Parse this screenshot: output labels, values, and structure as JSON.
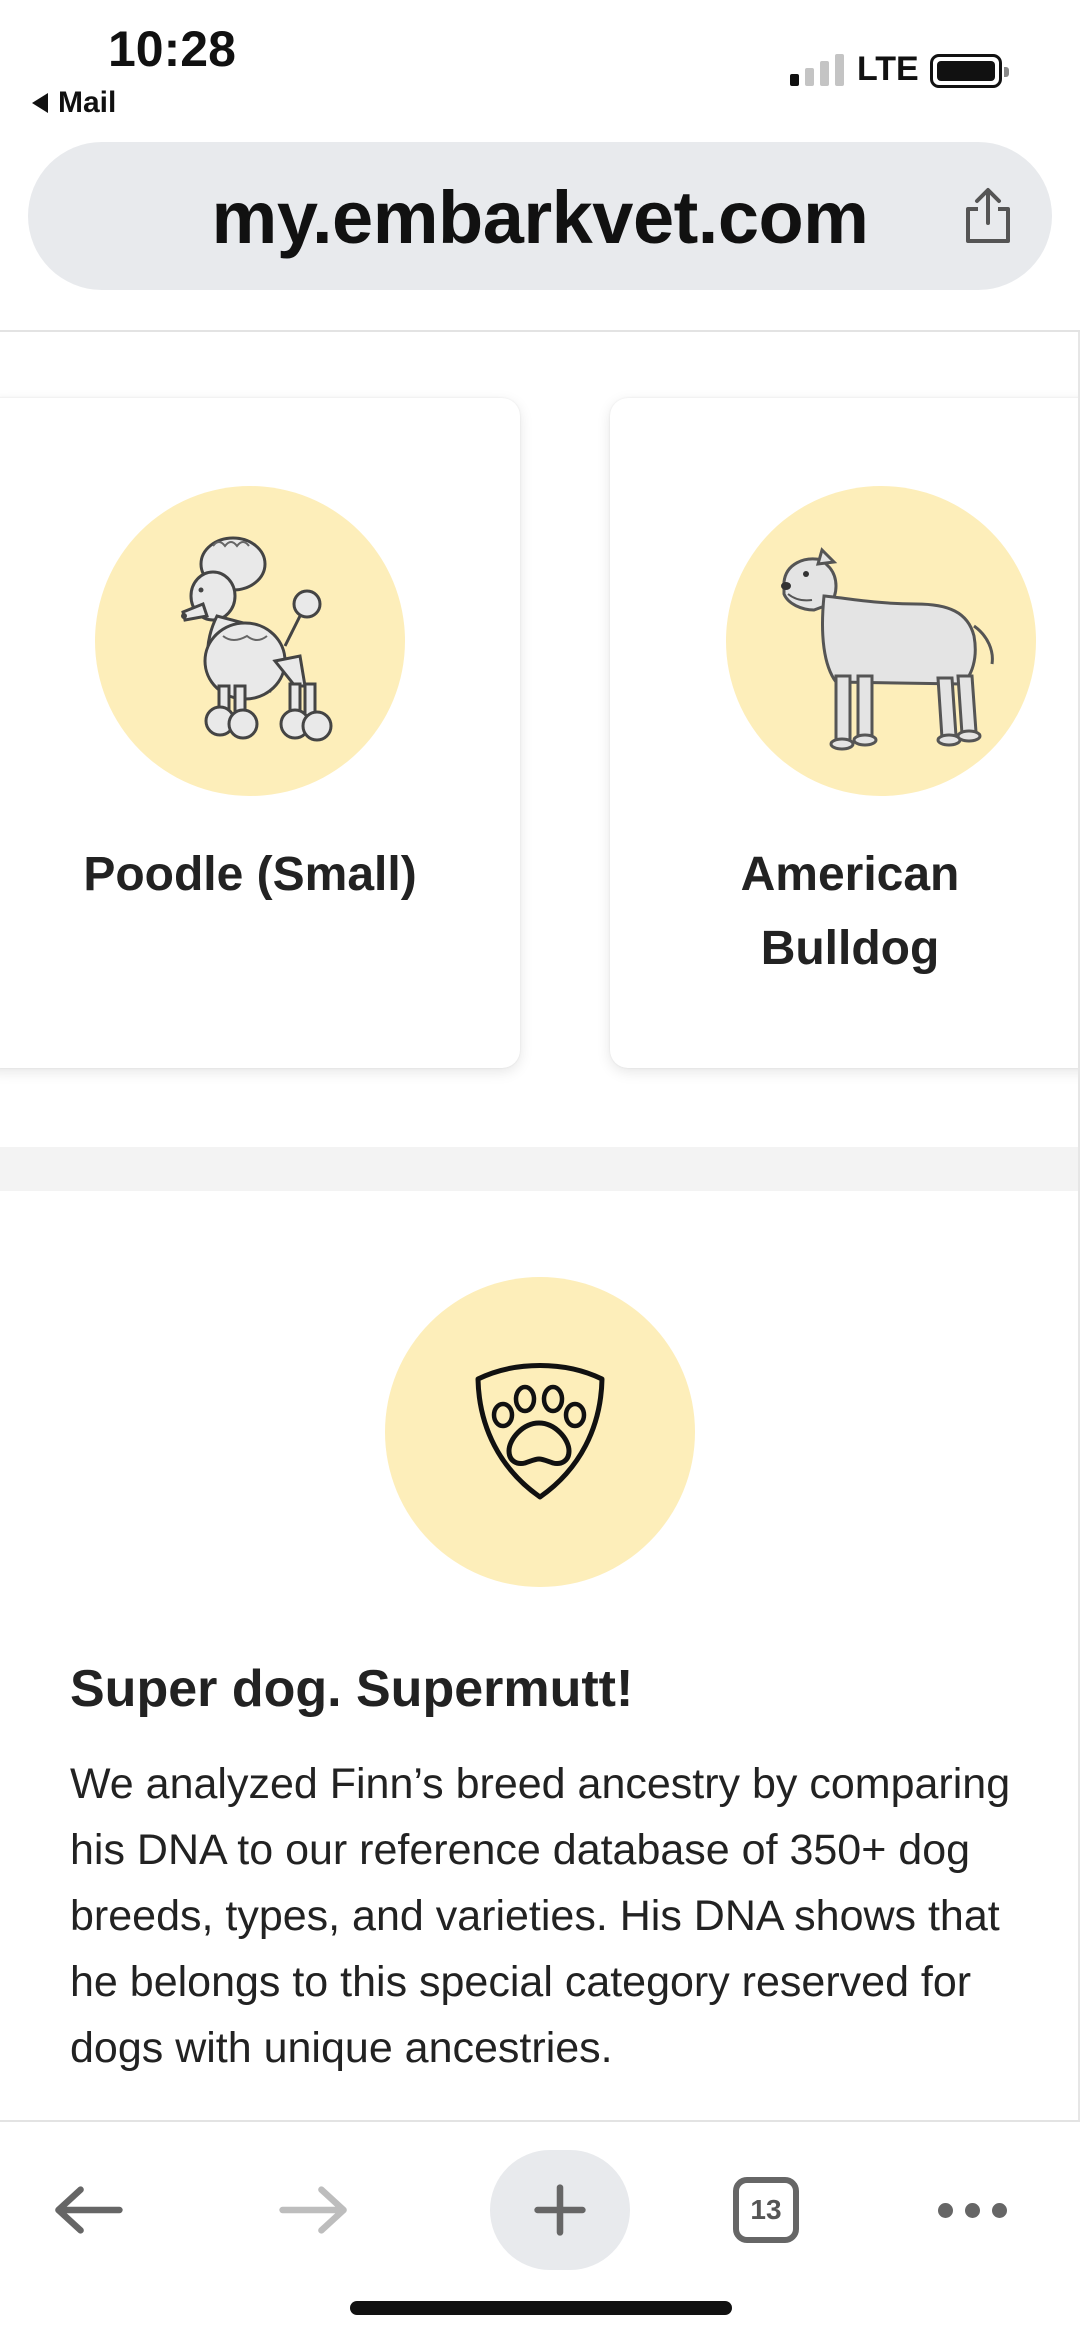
{
  "status_bar": {
    "time": "10:28",
    "back_app": "Mail",
    "network": "LTE",
    "signal_bars_filled": 1,
    "signal_bars_total": 4,
    "battery_level": 1.0
  },
  "browser": {
    "url": "my.embarkvet.com",
    "tab_count": "13"
  },
  "breed_cards": [
    {
      "name": "Poodle (Small)",
      "image": "poodle-illustration"
    },
    {
      "name": "American Bulldog",
      "name_line1": "American",
      "name_line2": "Bulldog",
      "image": "american-bulldog-illustration"
    }
  ],
  "supermutt": {
    "icon": "shield-paw-icon",
    "title": "Super dog. Supermutt!",
    "body": "We analyzed Finn’s breed ancestry by comparing his DNA to our reference database of 350+ dog breeds, types, and varieties. His DNA shows that he belongs to this special category reserved for dogs with unique ancestries."
  },
  "toolbar": {
    "back_icon": "arrow-left-icon",
    "forward_icon": "arrow-right-icon",
    "new_tab_icon": "plus-icon",
    "tabs_icon": "tabs-count-icon",
    "more_icon": "more-dots-icon"
  },
  "colors": {
    "accent_circle": "#fdeeba",
    "url_bar_bg": "#e8eaed",
    "text": "#222222"
  }
}
